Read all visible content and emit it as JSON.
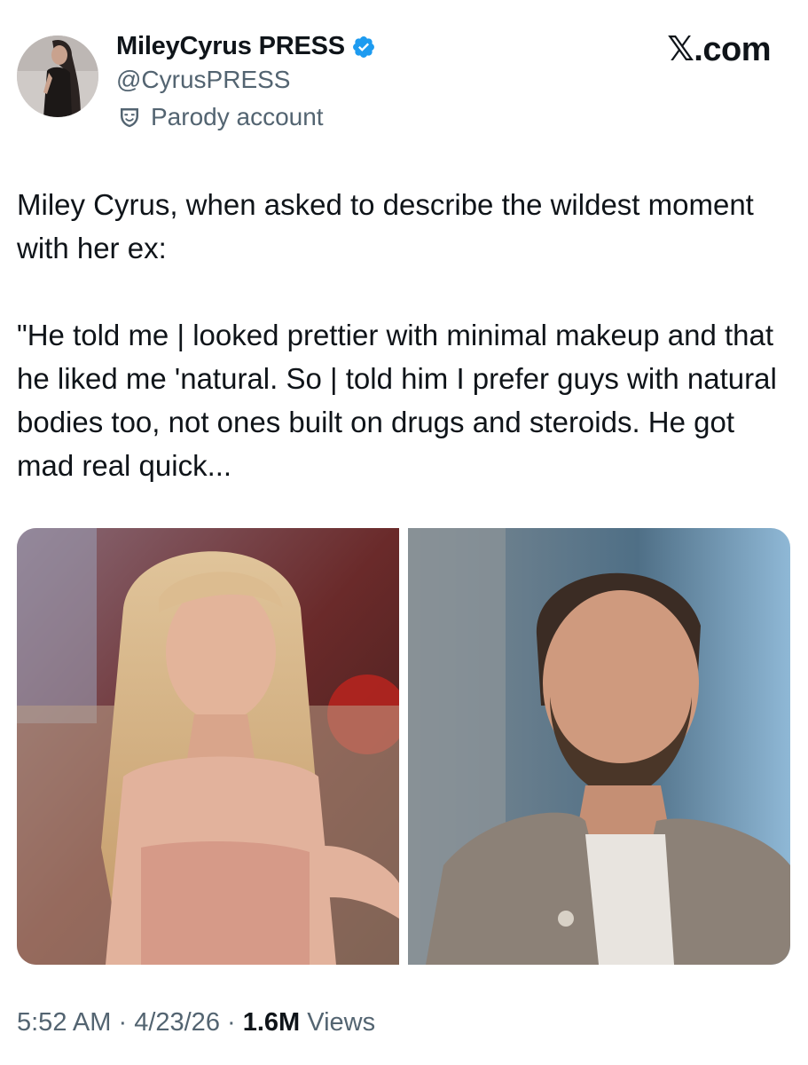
{
  "author": {
    "display_name": "MileyCyrus PRESS",
    "handle": "@CyrusPRESS",
    "label": "Parody account",
    "verified": true,
    "verified_color": "#1d9bf0",
    "avatar_icon": "profile-photo"
  },
  "brand": "𝕏.com",
  "tweet": {
    "paragraphs": [
      "Miley Cyrus, when asked to describe the wildest moment with her ex:",
      "\"He told me | looked prettier with minimal makeup and that he liked me 'natural. So | told him I prefer guys with natural bodies too, not ones built on drugs and steroids. He got mad real quick..."
    ]
  },
  "media": [
    {
      "icon": "photo-woman-blonde-bangs"
    },
    {
      "icon": "photo-man-beard"
    }
  ],
  "meta": {
    "time": "5:52 AM",
    "sep1": " · ",
    "date": "4/23/26",
    "sep2": " · ",
    "views_count": "1.6M",
    "views_label": " Views"
  }
}
